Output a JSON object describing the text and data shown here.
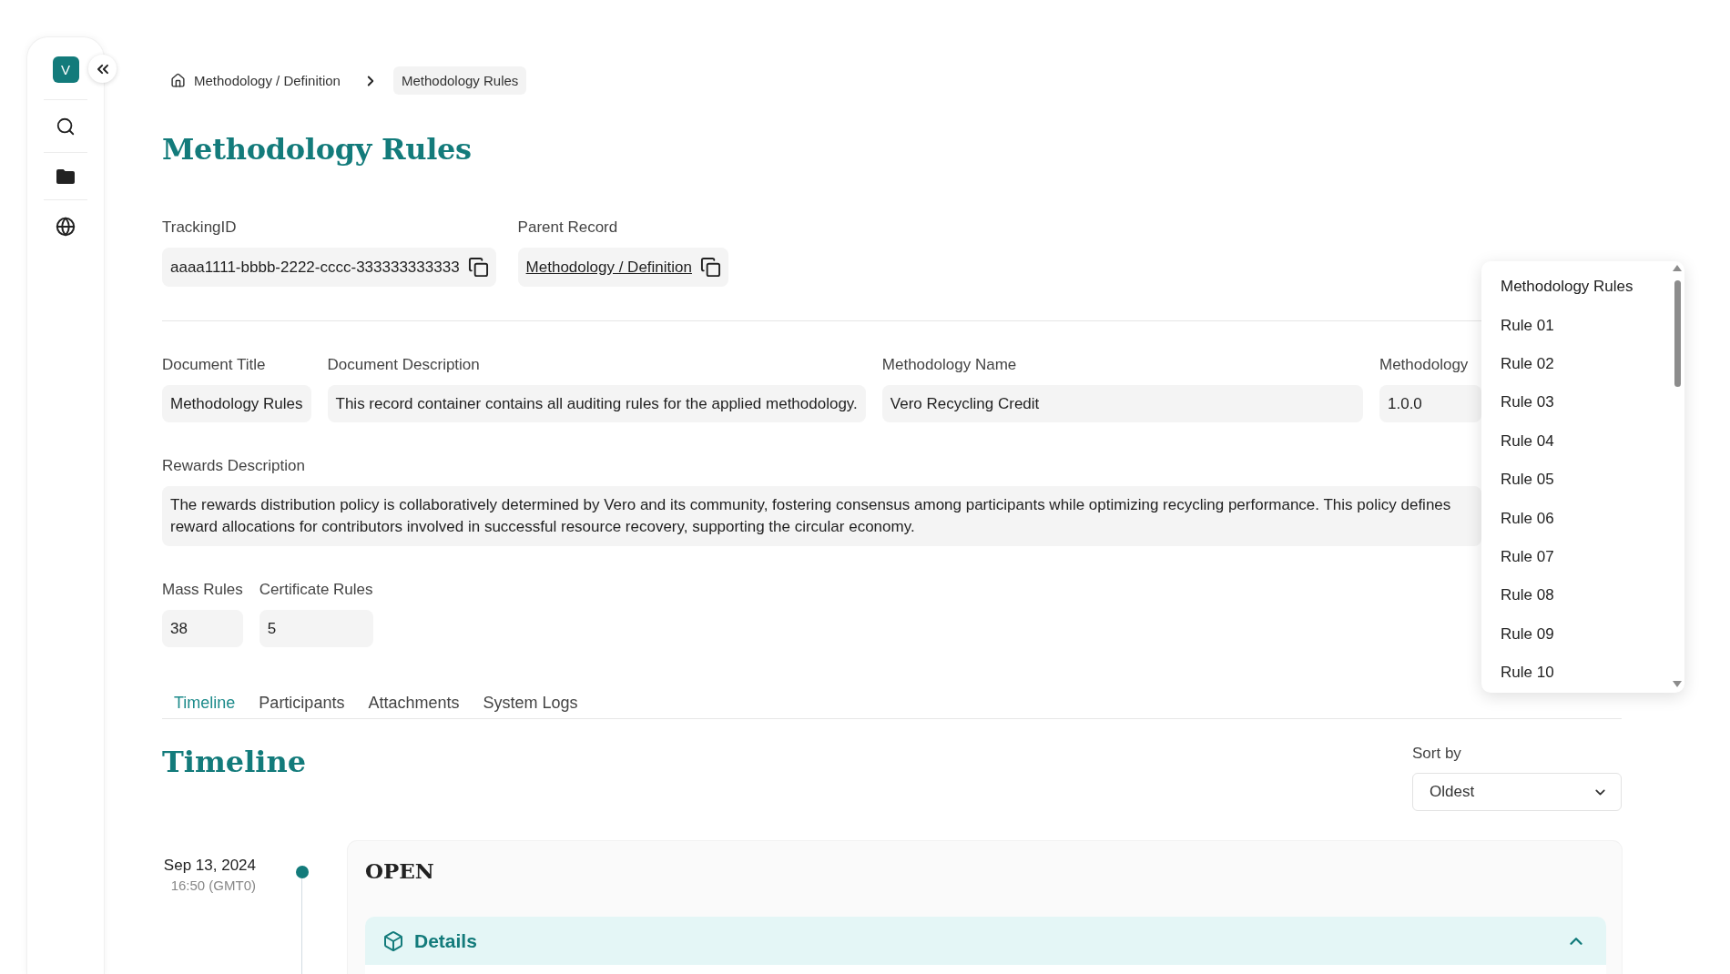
{
  "sidebar": {
    "avatar": "V"
  },
  "breadcrumb": [
    {
      "label": "Methodology / Definition",
      "current": false
    },
    {
      "label": "Methodology Rules",
      "current": true
    }
  ],
  "title": "Methodology Rules",
  "record_fields": [
    {
      "label": "TrackingID",
      "value": "aaaa1111-bbbb-2222-cccc-333333333333",
      "kind": "text"
    },
    {
      "label": "Parent Record",
      "value": "Methodology / Definition",
      "kind": "link"
    }
  ],
  "field_rows": [
    {
      "fields": [
        {
          "label": "Document Title",
          "value": "Methodology Rules"
        },
        {
          "label": "Document Description",
          "value": "This record container contains all auditing rules for the applied methodology."
        },
        {
          "label": "Methodology Name",
          "value": "Vero Recycling Credit"
        },
        {
          "label": "Methodology",
          "value": "1.0.0"
        }
      ]
    },
    {
      "fields": [
        {
          "label": "Rewards Description",
          "value": "The rewards distribution policy is collaboratively determined by Vero and its community, fostering consensus among participants while optimizing recycling performance. This policy defines reward allocations for contributors involved in successful resource recovery, supporting the circular economy."
        }
      ]
    },
    {
      "fields": [
        {
          "label": "Mass Rules",
          "value": "38"
        },
        {
          "label": "Certificate Rules",
          "value": "5"
        }
      ]
    }
  ],
  "tabs": [
    {
      "label": "Timeline",
      "selected": true
    },
    {
      "label": "Participants",
      "selected": false
    },
    {
      "label": "Attachments",
      "selected": false
    },
    {
      "label": "System Logs",
      "selected": false
    }
  ],
  "timeline": {
    "heading": "Timeline",
    "sort": {
      "label": "Sort by",
      "value": "Oldest"
    },
    "entries": [
      {
        "date": "Sep 13, 2024",
        "time": "16:50 (GMT0)",
        "status": "OPEN",
        "details": {
          "title": "Details",
          "expanded": true
        }
      }
    ]
  },
  "rules_menu": {
    "items": [
      {
        "label": "Methodology Rules",
        "selected": false
      },
      {
        "label": "Rule 01",
        "selected": false
      },
      {
        "label": "Rule 02",
        "selected": false
      },
      {
        "label": "Rule 03",
        "selected": false
      },
      {
        "label": "Rule 04",
        "selected": false
      },
      {
        "label": "Rule 05",
        "selected": false
      },
      {
        "label": "Rule 06",
        "selected": false
      },
      {
        "label": "Rule 07",
        "selected": false
      },
      {
        "label": "Rule 08",
        "selected": false
      },
      {
        "label": "Rule 09",
        "selected": false
      },
      {
        "label": "Rule 10",
        "selected": false
      }
    ]
  }
}
